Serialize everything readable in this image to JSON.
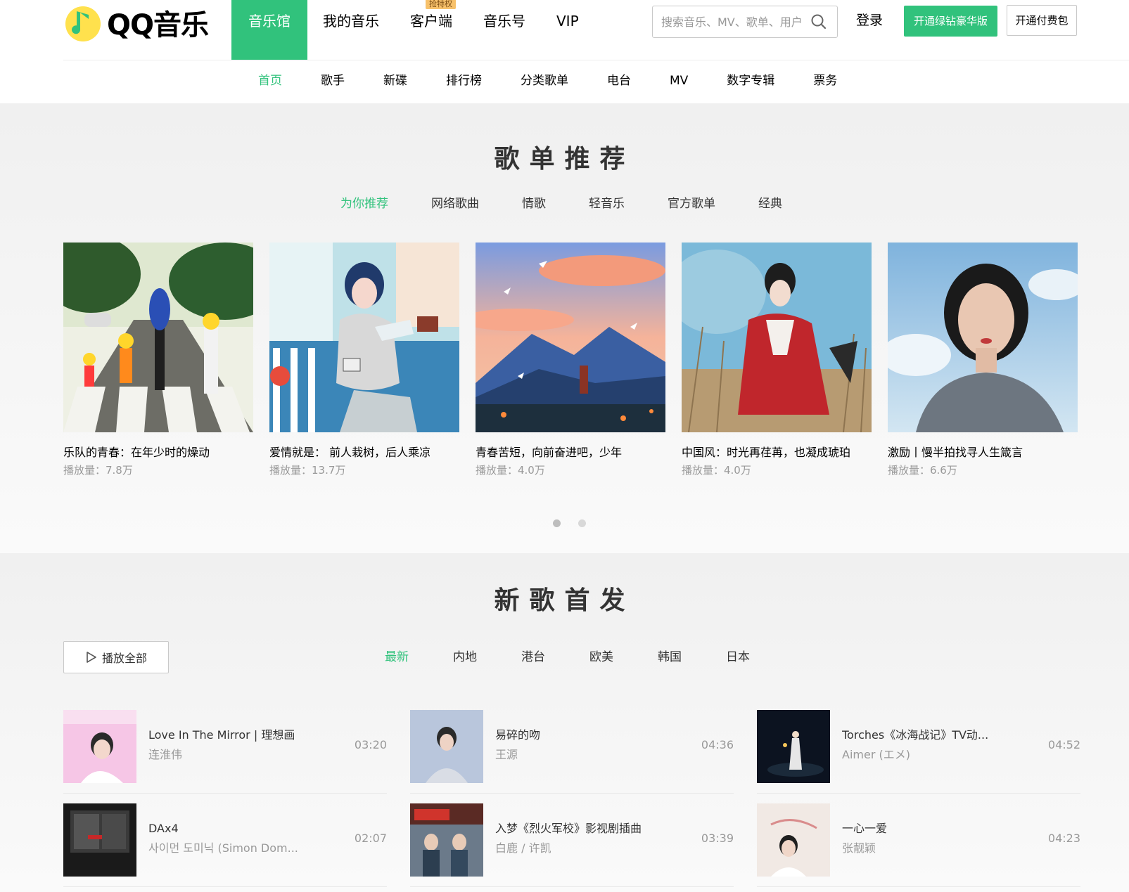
{
  "brand": {
    "name": "QQ音乐"
  },
  "main_nav": [
    {
      "label": "音乐馆",
      "active": true
    },
    {
      "label": "我的音乐",
      "active": false
    },
    {
      "label": "客户端",
      "active": false,
      "badge": "抢特权"
    },
    {
      "label": "音乐号",
      "active": false
    },
    {
      "label": "VIP",
      "active": false
    }
  ],
  "search": {
    "placeholder": "搜索音乐、MV、歌单、用户"
  },
  "account": {
    "login_label": "登录",
    "vip_label": "开通绿钻豪华版",
    "pay_label": "开通付费包"
  },
  "sub_nav": [
    {
      "label": "首页",
      "active": true
    },
    {
      "label": "歌手"
    },
    {
      "label": "新碟"
    },
    {
      "label": "排行榜"
    },
    {
      "label": "分类歌单"
    },
    {
      "label": "电台"
    },
    {
      "label": "MV"
    },
    {
      "label": "数字专辑"
    },
    {
      "label": "票务"
    }
  ],
  "playlists": {
    "title": "歌单推荐",
    "tabs": [
      "为你推荐",
      "网络歌曲",
      "情歌",
      "轻音乐",
      "官方歌单",
      "经典"
    ],
    "active_tab": 0,
    "items": [
      {
        "name": "乐队的青春：在年少时的燥动",
        "plays": "播放量：7.8万"
      },
      {
        "name": "爱情就是： 前人栽树，后人乘凉",
        "plays": "播放量：13.7万"
      },
      {
        "name": "青春苦短，向前奋进吧，少年",
        "plays": "播放量：4.0万"
      },
      {
        "name": "中国风：时光再荏苒，也凝成琥珀",
        "plays": "播放量：4.0万"
      },
      {
        "name": "激励丨慢半拍找寻人生箴言",
        "plays": "播放量：6.6万"
      }
    ],
    "page_indicator": {
      "pages": 2,
      "current": 1
    }
  },
  "new_songs": {
    "title": "新歌首发",
    "play_all_label": "播放全部",
    "tabs": [
      "最新",
      "内地",
      "港台",
      "欧美",
      "韩国",
      "日本"
    ],
    "active_tab": 0,
    "songs": [
      {
        "title": "Love In The Mirror | 理想画",
        "artist": "连淮伟",
        "duration": "03:20"
      },
      {
        "title": "易碎的吻",
        "artist": "王源",
        "duration": "04:36"
      },
      {
        "title": "Torches《冰海战记》TV动...",
        "artist": "Aimer (エメ)",
        "duration": "04:52"
      },
      {
        "title": "DAx4",
        "artist": "사이먼 도미닉 (Simon Dom...",
        "duration": "02:07"
      },
      {
        "title": "入梦《烈火军校》影视剧插曲",
        "artist": "白鹿 / 许凯",
        "duration": "03:39"
      },
      {
        "title": "一心一爱",
        "artist": "张靓颖",
        "duration": "04:23"
      }
    ]
  },
  "colors": {
    "accent": "#31c27c",
    "text": "#333333",
    "muted": "#999999"
  },
  "icons": {
    "search": "search-icon",
    "play": "play-outline-icon",
    "logo": "qq-music-note-icon"
  }
}
